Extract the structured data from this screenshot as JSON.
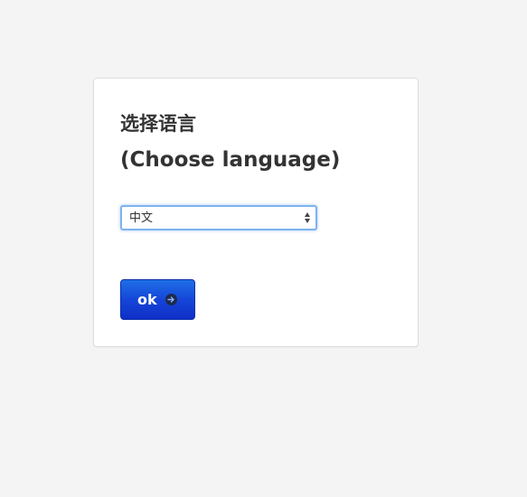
{
  "page": {
    "background": "#f4f4f4"
  },
  "dialog": {
    "title_chinese": "选择语言",
    "title_english": "(Choose language)",
    "language_select": {
      "selected_value": "中文"
    },
    "ok_button": {
      "label": "ok",
      "icon": "arrow-right-circle-icon",
      "color": "#1546d8"
    }
  }
}
